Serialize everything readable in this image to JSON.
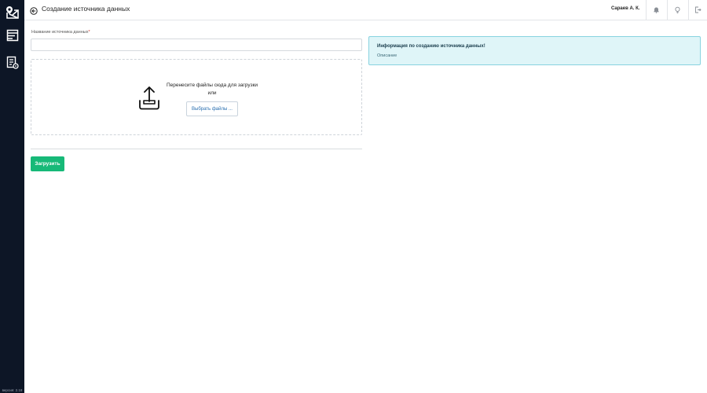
{
  "header": {
    "title": "Создание источника данных",
    "user_name": "Сараев А. К."
  },
  "sidebar": {
    "icons": [
      "map-logo-icon",
      "layers-list-icon",
      "document-settings-icon"
    ],
    "version": "версия: 2.18"
  },
  "form": {
    "name_label": "Название источника данных",
    "required_mark": "*",
    "name_value": "",
    "dropzone_text": "Перенесите файлы сюда для загрузки",
    "dropzone_or": "или",
    "choose_files_label": "Выбрать файлы ...",
    "upload_label": "Загрузить"
  },
  "info": {
    "title": "Информация по созданию источника данных!",
    "description": "Описание"
  },
  "colors": {
    "sidebar_bg": "#0d1626",
    "accent_green": "#17b978",
    "info_bg": "#dff5f8",
    "info_border": "#88d3e0",
    "link_blue": "#2a6fb0"
  }
}
